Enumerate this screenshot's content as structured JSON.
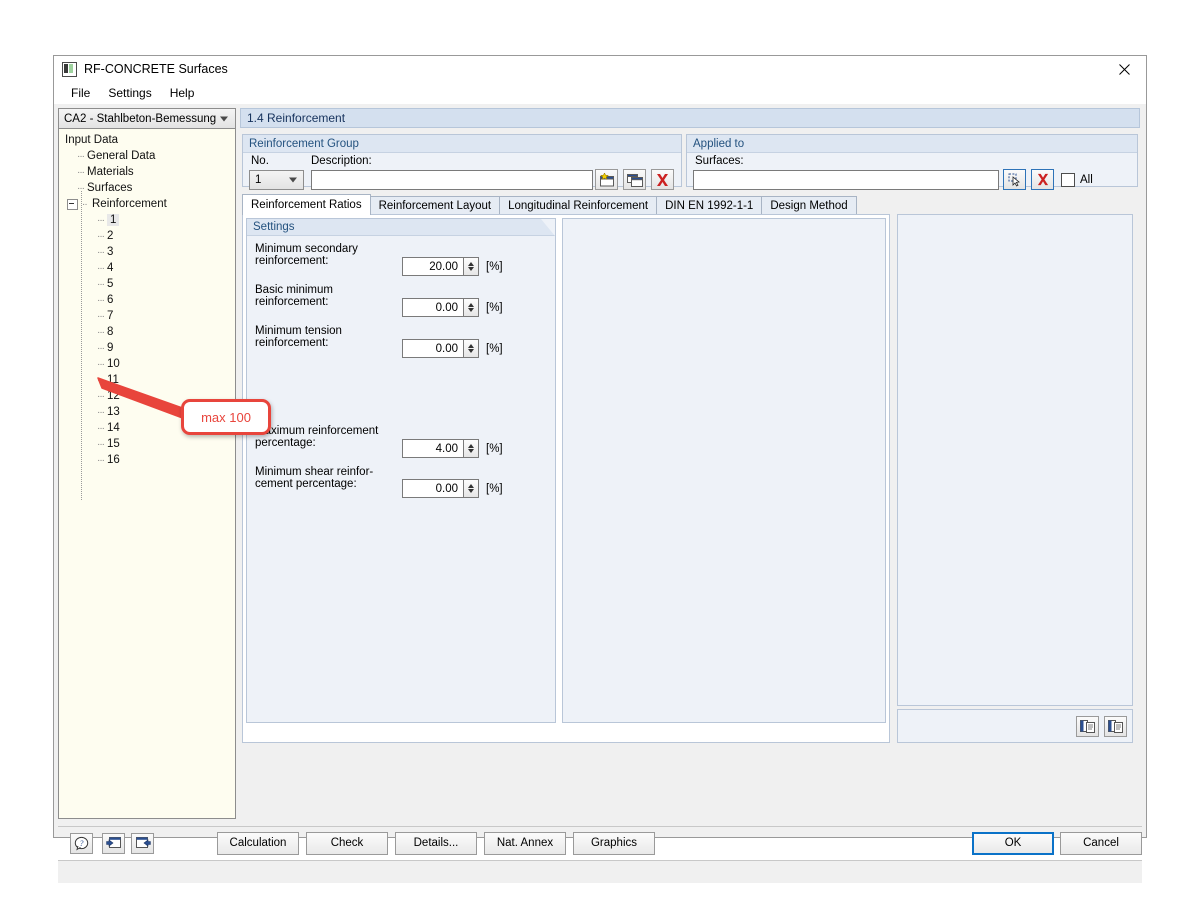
{
  "window": {
    "title": "RF-CONCRETE Surfaces",
    "app_icon": "app-icon",
    "close_icon": "close-icon"
  },
  "menu": {
    "items": [
      {
        "label": "File"
      },
      {
        "label": "Settings"
      },
      {
        "label": "Help"
      }
    ]
  },
  "sidebar": {
    "combo_value": "CA2 - Stahlbeton-Bemessung",
    "tree": [
      {
        "label": "Input Data",
        "level": 0
      },
      {
        "label": "General Data",
        "level": 1
      },
      {
        "label": "Materials",
        "level": 1
      },
      {
        "label": "Surfaces",
        "level": 1
      },
      {
        "label": "Reinforcement",
        "level": 1
      },
      {
        "label": "1",
        "level": 2
      },
      {
        "label": "2",
        "level": 2
      },
      {
        "label": "3",
        "level": 2
      },
      {
        "label": "4",
        "level": 2
      },
      {
        "label": "5",
        "level": 2
      },
      {
        "label": "6",
        "level": 2
      },
      {
        "label": "7",
        "level": 2
      },
      {
        "label": "8",
        "level": 2
      },
      {
        "label": "9",
        "level": 2
      },
      {
        "label": "10",
        "level": 2
      },
      {
        "label": "11",
        "level": 2
      },
      {
        "label": "12",
        "level": 2
      },
      {
        "label": "13",
        "level": 2
      },
      {
        "label": "14",
        "level": 2
      },
      {
        "label": "15",
        "level": 2
      },
      {
        "label": "16",
        "level": 2
      }
    ]
  },
  "main": {
    "header_title": "1.4 Reinforcement",
    "reinforcement_group": {
      "title": "Reinforcement Group",
      "no_label": "No.",
      "no_value": "1",
      "description_label": "Description:",
      "description_value": "",
      "buttons": [
        {
          "name": "new-group-button"
        },
        {
          "name": "copy-group-button"
        },
        {
          "name": "delete-group-button"
        }
      ]
    },
    "applied_to": {
      "title": "Applied to",
      "surfaces_label": "Surfaces:",
      "surfaces_value": "",
      "all_label": "All",
      "all_checked": false
    },
    "tabs": [
      {
        "label": "Reinforcement Ratios",
        "active": true
      },
      {
        "label": "Reinforcement Layout",
        "active": false
      },
      {
        "label": "Longitudinal Reinforcement",
        "active": false
      },
      {
        "label": "DIN EN 1992-1-1",
        "active": false
      },
      {
        "label": "Design Method",
        "active": false
      }
    ],
    "settings": {
      "title": "Settings",
      "fields": [
        {
          "label_line1": "Minimum secondary",
          "label_line2": "reinforcement:",
          "value": "20.00",
          "unit": "[%]"
        },
        {
          "label_line1": "Basic minimum",
          "label_line2": "reinforcement:",
          "value": "0.00",
          "unit": "[%]"
        },
        {
          "label_line1": "Minimum tension",
          "label_line2": "reinforcement:",
          "value": "0.00",
          "unit": "[%]"
        },
        {
          "label_line1": "Maximum reinforcement",
          "label_line2": "percentage:",
          "value": "4.00",
          "unit": "[%]"
        },
        {
          "label_line1": "Minimum shear reinfor-",
          "label_line2": "cement percentage:",
          "value": "0.00",
          "unit": "[%]"
        }
      ]
    }
  },
  "bottom": {
    "icon_buttons": [
      {
        "name": "help-button"
      },
      {
        "name": "previous-button"
      },
      {
        "name": "next-button"
      }
    ],
    "buttons": [
      {
        "label": "Calculation"
      },
      {
        "label": "Check"
      },
      {
        "label": "Details..."
      },
      {
        "label": "Nat. Annex"
      },
      {
        "label": "Graphics"
      }
    ],
    "ok_label": "OK",
    "cancel_label": "Cancel"
  },
  "annotation": {
    "callout_text": "max 100",
    "callout_color": "#e8453c"
  }
}
